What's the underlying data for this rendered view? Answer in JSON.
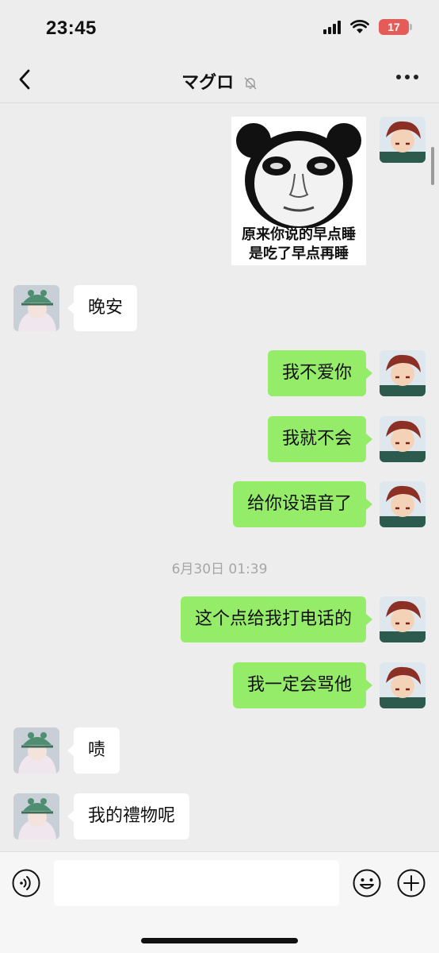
{
  "status": {
    "time": "23:45",
    "battery": "17"
  },
  "header": {
    "title": "マグロ"
  },
  "sticker": {
    "caption_line1": "原来你说的早点睡",
    "caption_line2": "是吃了早点再睡"
  },
  "messages": [
    {
      "text": "晚安"
    },
    {
      "text": "我不爱你"
    },
    {
      "text": "我就不会"
    },
    {
      "text": "给你设语音了"
    },
    {
      "text": "这个点给我打电话的"
    },
    {
      "text": "我一定会骂他"
    },
    {
      "text": "啧"
    },
    {
      "text": "我的禮物呢"
    }
  ],
  "timestamp": "6月30日 01:39",
  "input": {
    "placeholder": ""
  },
  "colors": {
    "outgoing_bubble": "#95ec69",
    "incoming_bubble": "#ffffff",
    "background": "#ededed",
    "battery_low": "#e55b58"
  },
  "icons": [
    "back-icon",
    "mute-icon",
    "more-icon",
    "voice-icon",
    "emoji-icon",
    "plus-icon"
  ]
}
